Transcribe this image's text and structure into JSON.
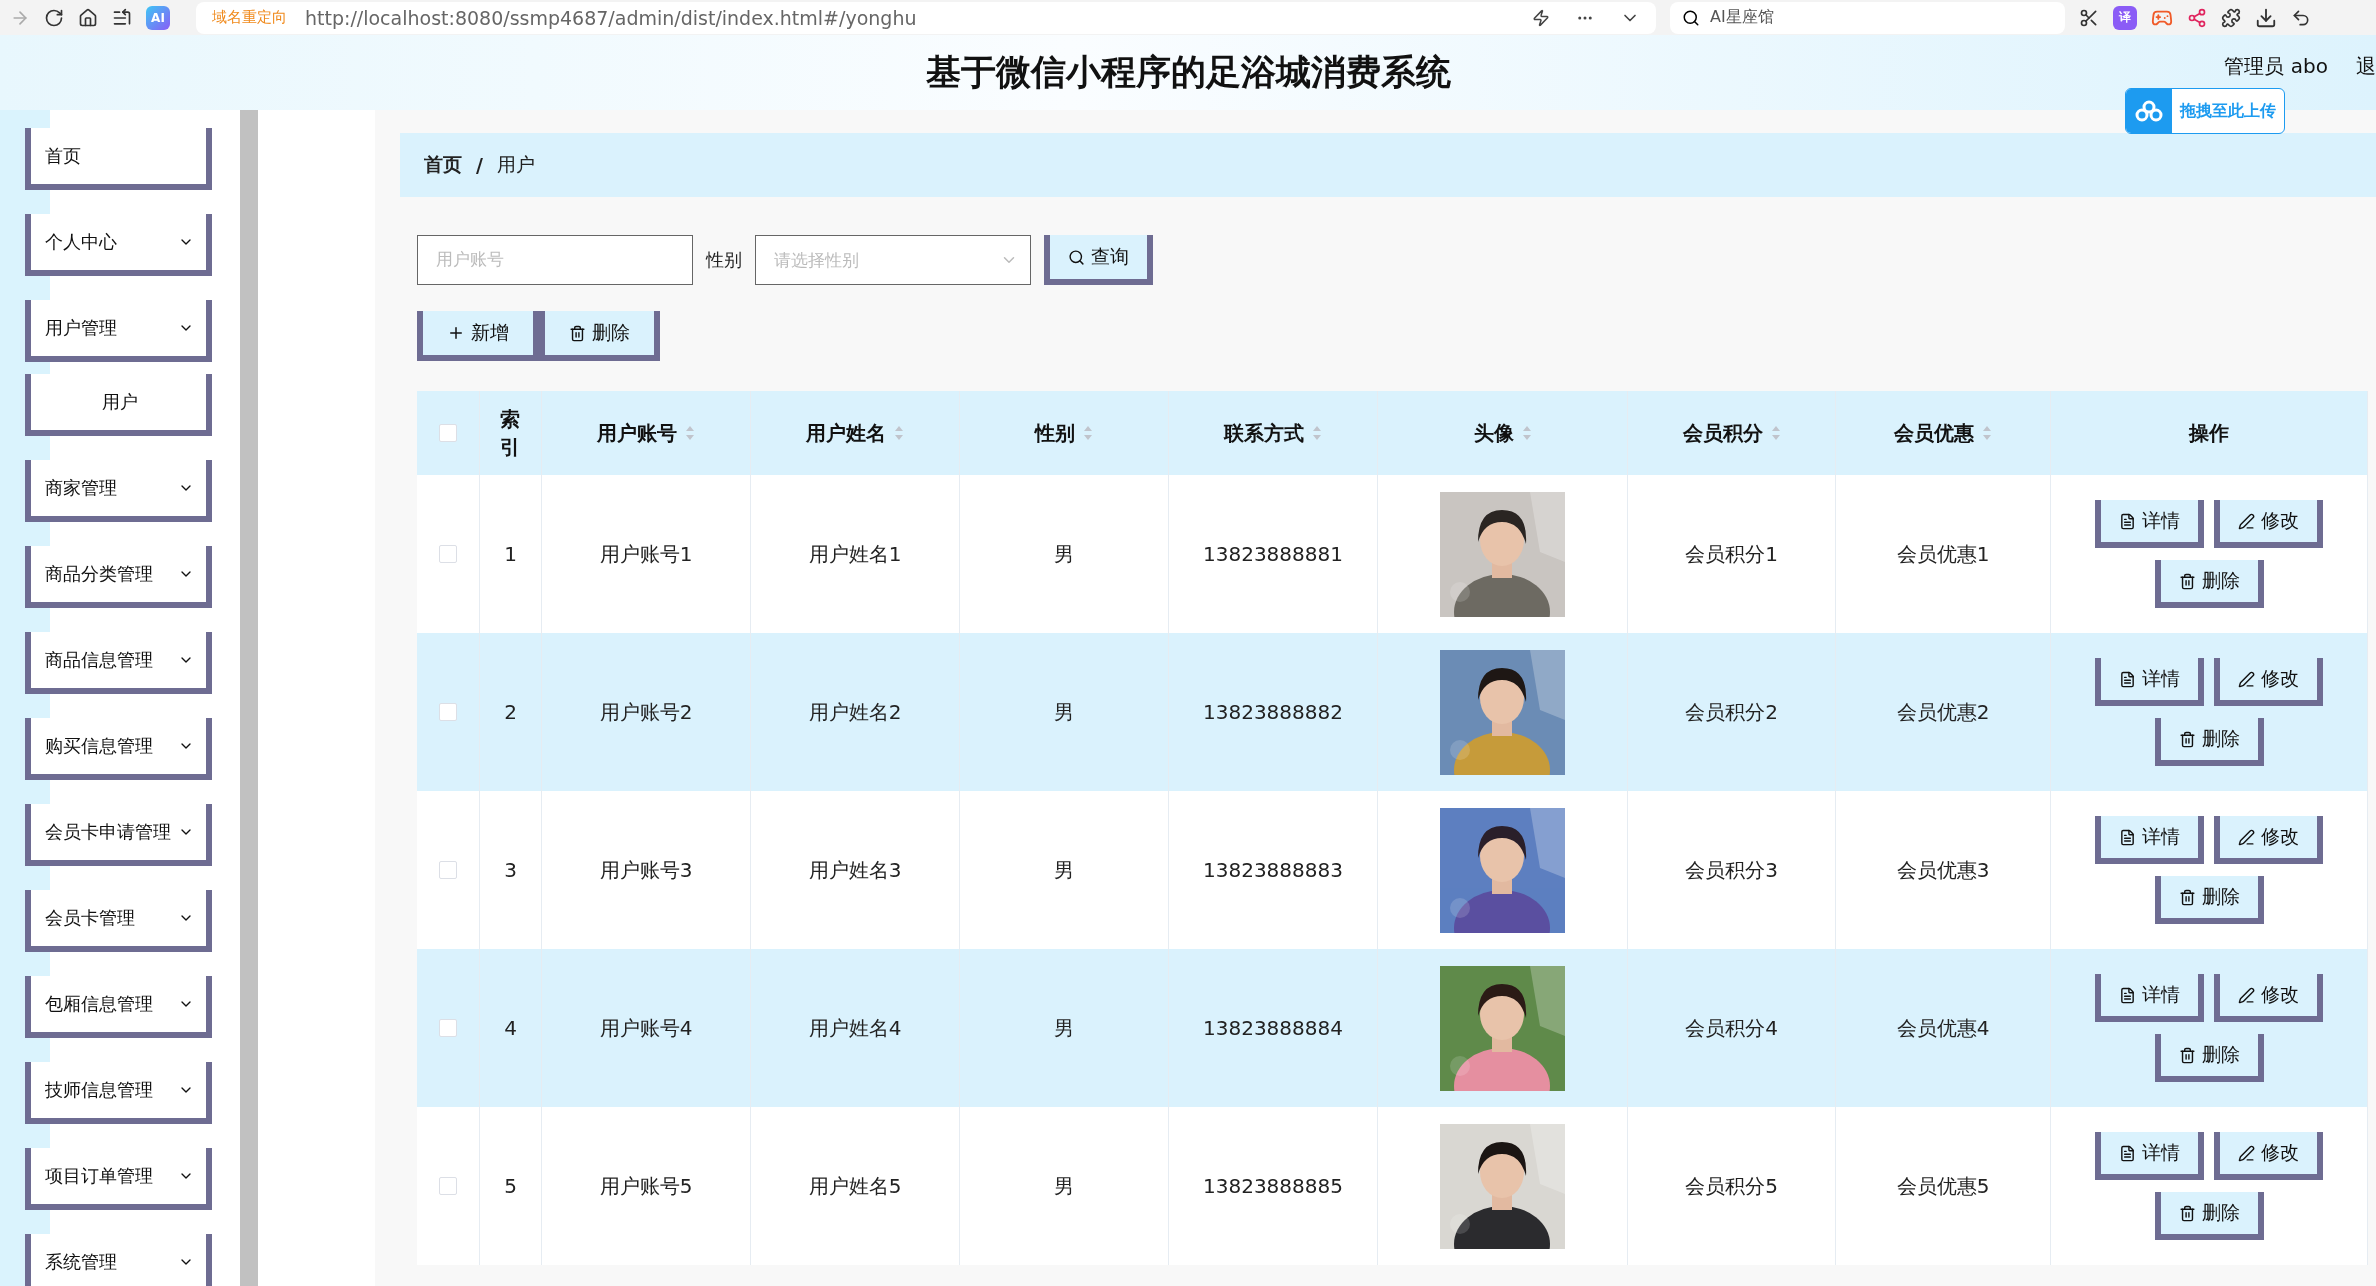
{
  "browser": {
    "ai_badge": "AI",
    "redirect_badge": "域名重定向",
    "url": "http://localhost:8080/ssmp4687/admin/dist/index.html#/yonghu",
    "search": "AI星座馆",
    "translate_badge": "译"
  },
  "header": {
    "title": "基于微信小程序的足浴城消费系统",
    "user": "管理员 abo",
    "logout": "退",
    "upload": "拖拽至此上传"
  },
  "sidebar": [
    {
      "label": "首页",
      "kind": "link"
    },
    {
      "label": "个人中心",
      "kind": "submenu"
    },
    {
      "label": "用户管理",
      "kind": "submenu",
      "children": [
        {
          "label": "用户"
        }
      ]
    },
    {
      "label": "商家管理",
      "kind": "submenu"
    },
    {
      "label": "商品分类管理",
      "kind": "submenu"
    },
    {
      "label": "商品信息管理",
      "kind": "submenu"
    },
    {
      "label": "购买信息管理",
      "kind": "submenu"
    },
    {
      "label": "会员卡申请管理",
      "kind": "submenu"
    },
    {
      "label": "会员卡管理",
      "kind": "submenu"
    },
    {
      "label": "包厢信息管理",
      "kind": "submenu"
    },
    {
      "label": "技师信息管理",
      "kind": "submenu"
    },
    {
      "label": "项目订单管理",
      "kind": "submenu"
    },
    {
      "label": "系统管理",
      "kind": "submenu"
    }
  ],
  "breadcrumb": {
    "items": [
      "首页",
      "用户"
    ],
    "separator": "/"
  },
  "filters": {
    "account_placeholder": "用户账号",
    "gender_label": "性别",
    "gender_placeholder": "请选择性别",
    "search_button": "查询"
  },
  "toolbar": [
    {
      "kind": "add",
      "label": "新增"
    },
    {
      "kind": "delete",
      "label": "删除"
    }
  ],
  "table": {
    "select_all_checked": false,
    "columns": [
      {
        "label": "索引",
        "sortable": false
      },
      {
        "label": "用户账号",
        "sortable": true
      },
      {
        "label": "用户姓名",
        "sortable": true
      },
      {
        "label": "性别",
        "sortable": true
      },
      {
        "label": "联系方式",
        "sortable": true
      },
      {
        "label": "头像",
        "sortable": true
      },
      {
        "label": "会员积分",
        "sortable": true
      },
      {
        "label": "会员优惠",
        "sortable": true
      },
      {
        "label": "操作",
        "sortable": false
      }
    ],
    "rows": [
      {
        "checked": false,
        "index": "1",
        "account": "用户账号1",
        "name": "用户姓名1",
        "gender": "男",
        "phone": "13823888881",
        "points": "会员积分1",
        "discount": "会员优惠1",
        "actions": [
          {
            "kind": "detail",
            "label": "详情"
          },
          {
            "kind": "edit",
            "label": "修改"
          },
          {
            "kind": "delete",
            "label": "删除"
          }
        ]
      },
      {
        "checked": false,
        "index": "2",
        "account": "用户账号2",
        "name": "用户姓名2",
        "gender": "男",
        "phone": "13823888882",
        "points": "会员积分2",
        "discount": "会员优惠2",
        "actions": [
          {
            "kind": "detail",
            "label": "详情"
          },
          {
            "kind": "edit",
            "label": "修改"
          },
          {
            "kind": "delete",
            "label": "删除"
          }
        ]
      },
      {
        "checked": false,
        "index": "3",
        "account": "用户账号3",
        "name": "用户姓名3",
        "gender": "男",
        "phone": "13823888883",
        "points": "会员积分3",
        "discount": "会员优惠3",
        "actions": [
          {
            "kind": "detail",
            "label": "详情"
          },
          {
            "kind": "edit",
            "label": "修改"
          },
          {
            "kind": "delete",
            "label": "删除"
          }
        ]
      },
      {
        "checked": false,
        "index": "4",
        "account": "用户账号4",
        "name": "用户姓名4",
        "gender": "男",
        "phone": "13823888884",
        "points": "会员积分4",
        "discount": "会员优惠4",
        "actions": [
          {
            "kind": "detail",
            "label": "详情"
          },
          {
            "kind": "edit",
            "label": "修改"
          },
          {
            "kind": "delete",
            "label": "删除"
          }
        ]
      },
      {
        "checked": false,
        "index": "5",
        "account": "用户账号5",
        "name": "用户姓名5",
        "gender": "男",
        "phone": "13823888885",
        "points": "会员积分5",
        "discount": "会员优惠5",
        "actions": [
          {
            "kind": "detail",
            "label": "详情"
          },
          {
            "kind": "edit",
            "label": "修改"
          },
          {
            "kind": "delete",
            "label": "删除"
          }
        ]
      }
    ]
  }
}
